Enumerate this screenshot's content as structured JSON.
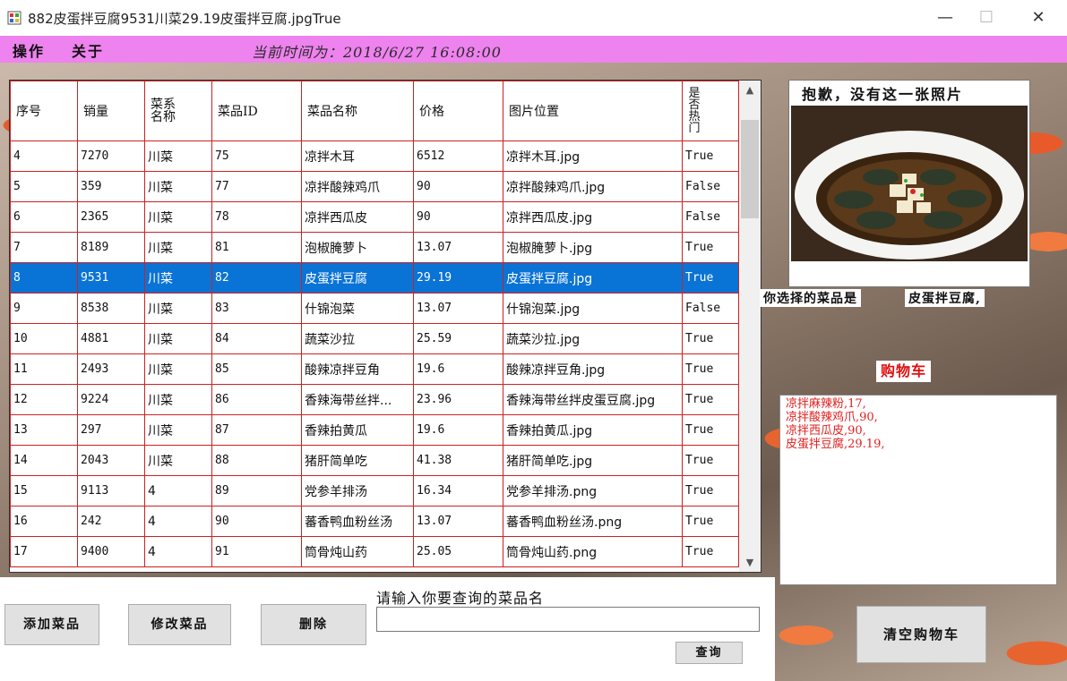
{
  "window": {
    "title": "882皮蛋拌豆腐9531川菜29.19皮蛋拌豆腐.jpgTrue",
    "minimize": "—",
    "maximize": "☐",
    "close": "✕"
  },
  "menu": {
    "items": [
      "操作",
      "关于"
    ],
    "time_label": "当前时间为：2018/6/27 16:08:00"
  },
  "grid": {
    "columns": [
      "序号",
      "销量",
      "菜系名称",
      "菜品ID",
      "菜品名称",
      "价格",
      "图片位置",
      "是否热门"
    ],
    "selected_index": 4,
    "rows": [
      [
        "4",
        "7270",
        "川菜",
        "75",
        "凉拌木耳",
        "6512",
        "凉拌木耳.jpg",
        "True"
      ],
      [
        "5",
        "359",
        "川菜",
        "77",
        "凉拌酸辣鸡爪",
        "90",
        "凉拌酸辣鸡爪.jpg",
        "False"
      ],
      [
        "6",
        "2365",
        "川菜",
        "78",
        "凉拌西瓜皮",
        "90",
        "凉拌西瓜皮.jpg",
        "False"
      ],
      [
        "7",
        "8189",
        "川菜",
        "81",
        "泡椒腌萝卜",
        "13.07",
        "泡椒腌萝卜.jpg",
        "True"
      ],
      [
        "8",
        "9531",
        "川菜",
        "82",
        "皮蛋拌豆腐",
        "29.19",
        "皮蛋拌豆腐.jpg",
        "True"
      ],
      [
        "9",
        "8538",
        "川菜",
        "83",
        "什锦泡菜",
        "13.07",
        "什锦泡菜.jpg",
        "False"
      ],
      [
        "10",
        "4881",
        "川菜",
        "84",
        "蔬菜沙拉",
        "25.59",
        "蔬菜沙拉.jpg",
        "True"
      ],
      [
        "11",
        "2493",
        "川菜",
        "85",
        "酸辣凉拌豆角",
        "19.6",
        "酸辣凉拌豆角.jpg",
        "True"
      ],
      [
        "12",
        "9224",
        "川菜",
        "86",
        "香辣海带丝拌...",
        "23.96",
        "香辣海带丝拌皮蛋豆腐.jpg",
        "True"
      ],
      [
        "13",
        "297",
        "川菜",
        "87",
        "香辣拍黄瓜",
        "19.6",
        "香辣拍黄瓜.jpg",
        "True"
      ],
      [
        "14",
        "2043",
        "川菜",
        "88",
        "猪肝简单吃",
        "41.38",
        "猪肝简单吃.jpg",
        "True"
      ],
      [
        "15",
        "9113",
        "4",
        "89",
        "党参羊排汤",
        "16.34",
        "党参羊排汤.png",
        "True"
      ],
      [
        "16",
        "242",
        "4",
        "90",
        "蕃香鸭血粉丝汤",
        "13.07",
        "蕃香鸭血粉丝汤.png",
        "True"
      ],
      [
        "17",
        "9400",
        "4",
        "91",
        "筒骨炖山药",
        "25.05",
        "筒骨炖山药.png",
        "True"
      ]
    ]
  },
  "photo": {
    "title": "抱歉，没有这一张照片"
  },
  "selection": {
    "label": "你选择的菜品是",
    "value": "皮蛋拌豆腐,"
  },
  "cart": {
    "title": "购物车",
    "items": [
      "凉拌麻辣粉,17,",
      "凉拌酸辣鸡爪,90,",
      "凉拌西瓜皮,90,",
      "皮蛋拌豆腐,29.19,"
    ],
    "clear_button": "清空购物车"
  },
  "actions": {
    "add": "添加菜品",
    "edit": "修改菜品",
    "delete": "删除"
  },
  "search": {
    "label": "请输入你要查询的菜品名",
    "value": "",
    "button": "查询"
  },
  "colors": {
    "menubar": "#ee82ee",
    "grid_border": "#cc2222",
    "selection": "#0a73d6",
    "cart_text": "#e02020"
  }
}
